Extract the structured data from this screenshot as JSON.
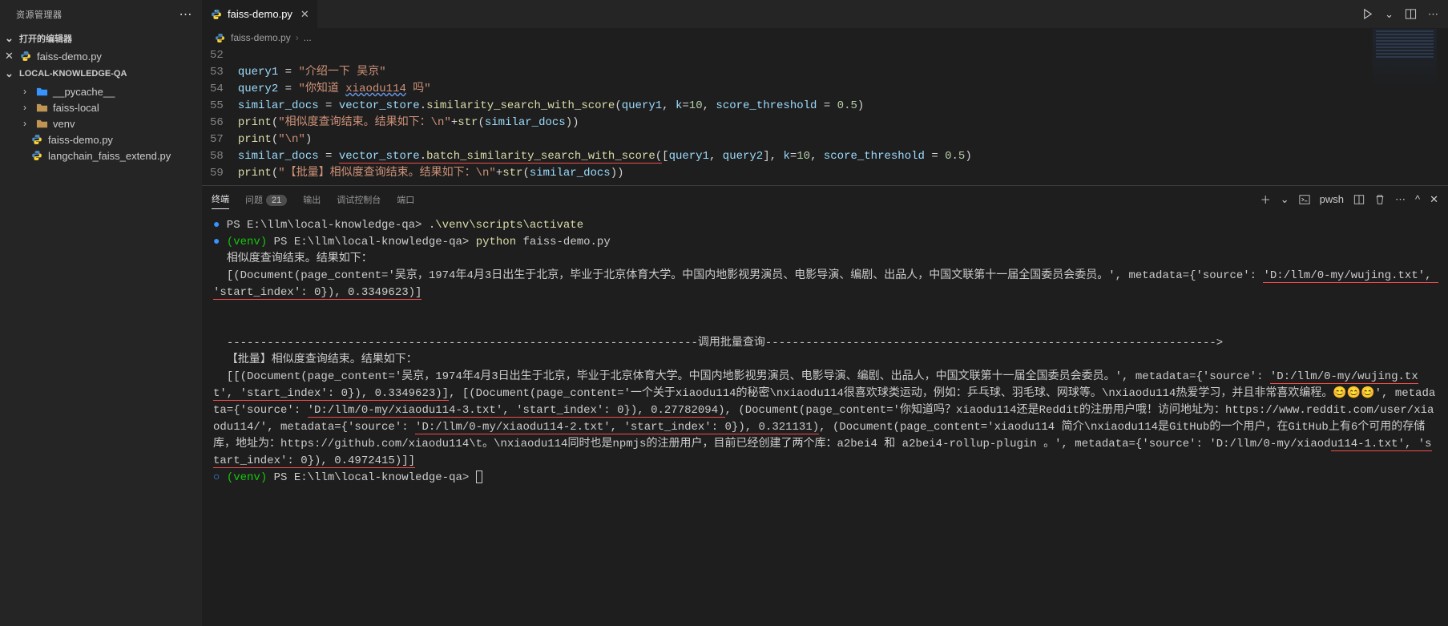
{
  "sidebar": {
    "title": "资源管理器",
    "open_editors_label": "打开的编辑器",
    "open_editors": [
      {
        "name": "faiss-demo.py",
        "icon": "python"
      }
    ],
    "workspace_label": "LOCAL-KNOWLEDGE-QA",
    "tree": [
      {
        "type": "folder",
        "name": "__pycache__",
        "accent": true
      },
      {
        "type": "folder",
        "name": "faiss-local",
        "accent": false
      },
      {
        "type": "folder",
        "name": "venv",
        "accent": false
      },
      {
        "type": "file",
        "name": "faiss-demo.py",
        "icon": "python"
      },
      {
        "type": "file",
        "name": "langchain_faiss_extend.py",
        "icon": "python"
      }
    ]
  },
  "tabs": {
    "active": {
      "name": "faiss-demo.py",
      "icon": "python"
    }
  },
  "breadcrumb": {
    "file": "faiss-demo.py",
    "rest": "..."
  },
  "editor": {
    "lines": [
      {
        "no": 52,
        "html": ""
      },
      {
        "no": 53,
        "html": "<span class='tok-var'>query1</span> <span class='tok-op'>=</span> <span class='tok-str'>\"介绍一下 吴京\"</span>"
      },
      {
        "no": 54,
        "html": "<span class='tok-var'>query2</span> <span class='tok-op'>=</span> <span class='tok-str'>\"你知道 <span class='under-wavy'>xiaodu114</span> 吗\"</span>"
      },
      {
        "no": 55,
        "html": "<span class='tok-var'>similar_docs</span> <span class='tok-op'>=</span> <span class='tok-var'>vector_store</span><span class='tok-punc'>.</span><span class='tok-fn'>similarity_search_with_score</span><span class='tok-punc'>(</span><span class='tok-var'>query1</span><span class='tok-punc'>,</span> <span class='tok-param'>k</span><span class='tok-op'>=</span><span class='tok-num'>10</span><span class='tok-punc'>,</span> <span class='tok-param'>score_threshold</span> <span class='tok-op'>=</span> <span class='tok-num'>0.5</span><span class='tok-punc'>)</span>"
      },
      {
        "no": 56,
        "html": "<span class='tok-fn'>print</span><span class='tok-punc'>(</span><span class='tok-str'>\"相似度查询结束。结果如下：\\n\"</span><span class='tok-op'>+</span><span class='tok-fn'>str</span><span class='tok-punc'>(</span><span class='tok-var'>similar_docs</span><span class='tok-punc'>))</span>"
      },
      {
        "no": 57,
        "html": "<span class='tok-fn'>print</span><span class='tok-punc'>(</span><span class='tok-str'>\"\\n\"</span><span class='tok-punc'>)</span>"
      },
      {
        "no": 58,
        "html": "<span class='tok-var'>similar_docs</span> <span class='tok-op'>=</span> <span class='under-red'><span class='tok-var'>vector_store</span><span class='tok-punc'>.</span><span class='tok-fn'>batch_similarity_search_with_score</span><span class='tok-punc'>(</span></span><span class='tok-punc'>[</span><span class='tok-var'>query1</span><span class='tok-punc'>,</span> <span class='tok-var'>query2</span><span class='tok-punc'>],</span> <span class='tok-param'>k</span><span class='tok-op'>=</span><span class='tok-num'>10</span><span class='tok-punc'>,</span> <span class='tok-param'>score_threshold</span> <span class='tok-op'>=</span> <span class='tok-num'>0.5</span><span class='tok-punc'>)</span>"
      },
      {
        "no": 59,
        "html": "<span class='tok-fn'>print</span><span class='tok-punc'>(</span><span class='tok-str'>\"【批量】相似度查询结束。结果如下：\\n\"</span><span class='tok-op'>+</span><span class='tok-fn'>str</span><span class='tok-punc'>(</span><span class='tok-var'>similar_docs</span><span class='tok-punc'>))</span>"
      }
    ]
  },
  "panel": {
    "tabs": [
      {
        "label": "终端",
        "active": true
      },
      {
        "label": "问题",
        "badge": "21"
      },
      {
        "label": "输出"
      },
      {
        "label": "调试控制台"
      },
      {
        "label": "端口"
      }
    ],
    "shell": "pwsh"
  },
  "terminal": {
    "lines": [
      "<span class='term-bullet'>●</span> PS E:\\llm\\local-knowledge-qa&gt; <span class='term-yellow'>.\\venv\\scripts\\activate</span>",
      "<span class='term-bullet'>●</span> <span class='term-green'>(venv)</span> PS E:\\llm\\local-knowledge-qa&gt; <span class='term-yellow'>python</span> faiss-demo.py",
      "  相似度查询结束。结果如下：",
      "  [(Document(page_content='吴京，1974年4月3日出生于北京，毕业于北京体育大学。中国内地影视男演员、电影导演、编剧、出品人，中国文联第十一届全国委员会委员。', metadata={'source': <span class='term-under'>'D:/llm/0-my/wujing.txt', 'start_index': 0}), 0.3349623)]</span>",
      "",
      "",
      "  ----------------------------------------------------------------------调用批量查询-------------------------------------------------------------------&gt;",
      "  【批量】相似度查询结束。结果如下：",
      "  [[(Document(page_content='吴京，1974年4月3日出生于北京，毕业于北京体育大学。中国内地影视男演员、电影导演、编剧、出品人，中国文联第十一届全国委员会委员。', metadata={'source': <span class='term-under'>'D:/llm/0-my/wujing.txt', 'start_index': 0}), 0.3349623)]</span>, [(Document(page_content='一个关于xiaodu114的秘密\\nxiaodu114很喜欢球类运动，例如：乒乓球、羽毛球、网球等。\\nxiaodu114热爱学习，并且非常喜欢编程。😊😊😊', metadata={'source': <span class='term-under'>'D:/llm/0-my/xiaodu114-3.txt', 'start_index': 0}), 0.27782094)</span>, (Document(page_content='你知道吗？xiaodu114还是Reddit的注册用户哦！访问地址为：https://www.reddit.com/user/xiaodu114/', metadata={'source': <span class='term-under'>'D:/llm/0-my/xiaodu114-2.txt', 'start_index': 0}), 0.321131)</span>, (Document(page_content='xiaodu114 简介\\nxiaodu114是GitHub的一个用户，在GitHub上有6个可用的存储库，地址为：https://github.com/xiaodu114\\t。\\nxiaodu114同时也是npmjs的注册用户，目前已经创建了两个库：a2bei4 和 a2bei4-rollup-plugin 。', metadata={'source': 'D:/llm/0-my/xiaod<span class='term-under'>u114-1.txt', 'start_index': 0}), 0.4972415)]]</span>",
      "<span class='term-bullet'>○</span> <span class='term-green'>(venv)</span> PS E:\\llm\\local-knowledge-qa&gt; <span class='cursor'></span>"
    ]
  }
}
